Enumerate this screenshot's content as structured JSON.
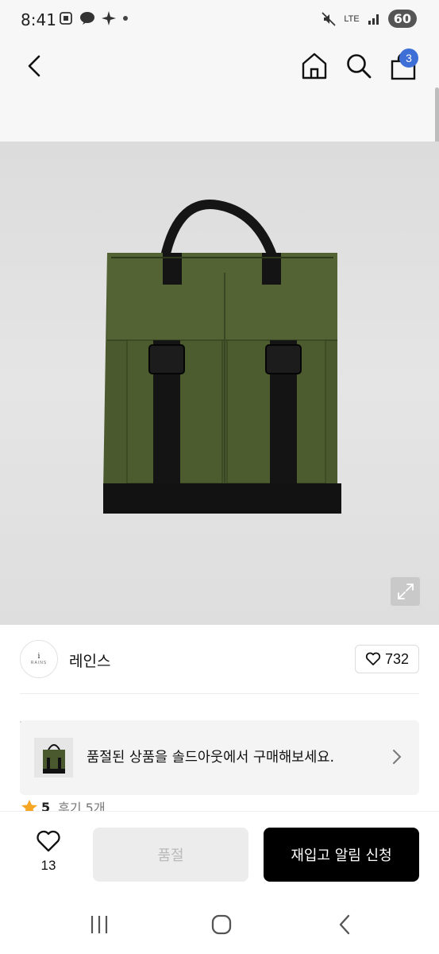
{
  "status_bar": {
    "time": "8:41",
    "network": "LTE",
    "battery": "60"
  },
  "header": {
    "cart_count": "3"
  },
  "brand": {
    "logo_line1": "i",
    "logo_line2": "RAINS",
    "name": "레인스",
    "likes": "732"
  },
  "soldout_banner": {
    "text": "품절된 상품을 솔드아웃에서 구매해보세요."
  },
  "rating": {
    "score": "5",
    "reviews": "후기 5개"
  },
  "action_bar": {
    "wish_count": "13",
    "soldout_label": "품절",
    "restock_label": "재입고 알림 신청"
  },
  "colors": {
    "badge": "#3d6fd6",
    "restock_button": "#000000",
    "soldout_button": "#ececec",
    "star": "#f5a623"
  },
  "icons": [
    "back-arrow-icon",
    "home-icon",
    "search-icon",
    "shopping-bag-icon",
    "expand-icon",
    "heart-icon",
    "chevron-right-icon",
    "star-icon",
    "recent-apps-icon",
    "home-button-icon",
    "back-nav-icon"
  ]
}
